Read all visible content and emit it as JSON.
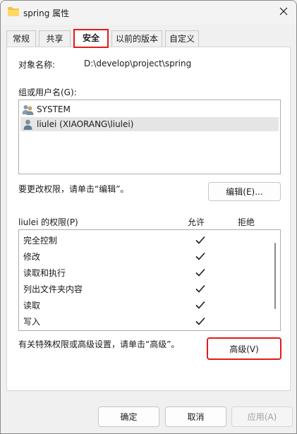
{
  "window": {
    "title": "spring 属性",
    "title_icon": "folder-icon",
    "close_icon": "close-icon"
  },
  "tabs": [
    {
      "label": "常规"
    },
    {
      "label": "共享"
    },
    {
      "label": "安全",
      "active": true
    },
    {
      "label": "以前的版本"
    },
    {
      "label": "自定义"
    }
  ],
  "security": {
    "object_label": "对象名称:",
    "object_path": "D:\\develop\\project\\spring",
    "group_label": "组或用户名(G):",
    "users": [
      {
        "name": "SYSTEM",
        "icon": "users-group-icon"
      },
      {
        "name": "liulei (XIAORANG\\liulei)",
        "icon": "user-icon",
        "selected": true
      }
    ],
    "edit_hint": "要更改权限，请单击“编辑”。",
    "edit_button": "编辑(E)...",
    "perm_label": "liulei 的权限(P)",
    "allow_header": "允许",
    "deny_header": "拒绝",
    "permissions": [
      {
        "name": "完全控制",
        "allow": true,
        "deny": false
      },
      {
        "name": "修改",
        "allow": true,
        "deny": false
      },
      {
        "name": "读取和执行",
        "allow": true,
        "deny": false
      },
      {
        "name": "列出文件夹内容",
        "allow": true,
        "deny": false
      },
      {
        "name": "读取",
        "allow": true,
        "deny": false
      },
      {
        "name": "写入",
        "allow": true,
        "deny": false
      }
    ],
    "advanced_hint": "有关特殊权限或高级设置，请单击“高级”。",
    "advanced_button": "高级(V)"
  },
  "footer": {
    "ok": "确定",
    "cancel": "取消",
    "apply": "应用(A)"
  },
  "colors": {
    "highlight_border": "#e21b1b",
    "selected_row": "#e5e5e5",
    "disabled_text": "#a0a0a0"
  }
}
